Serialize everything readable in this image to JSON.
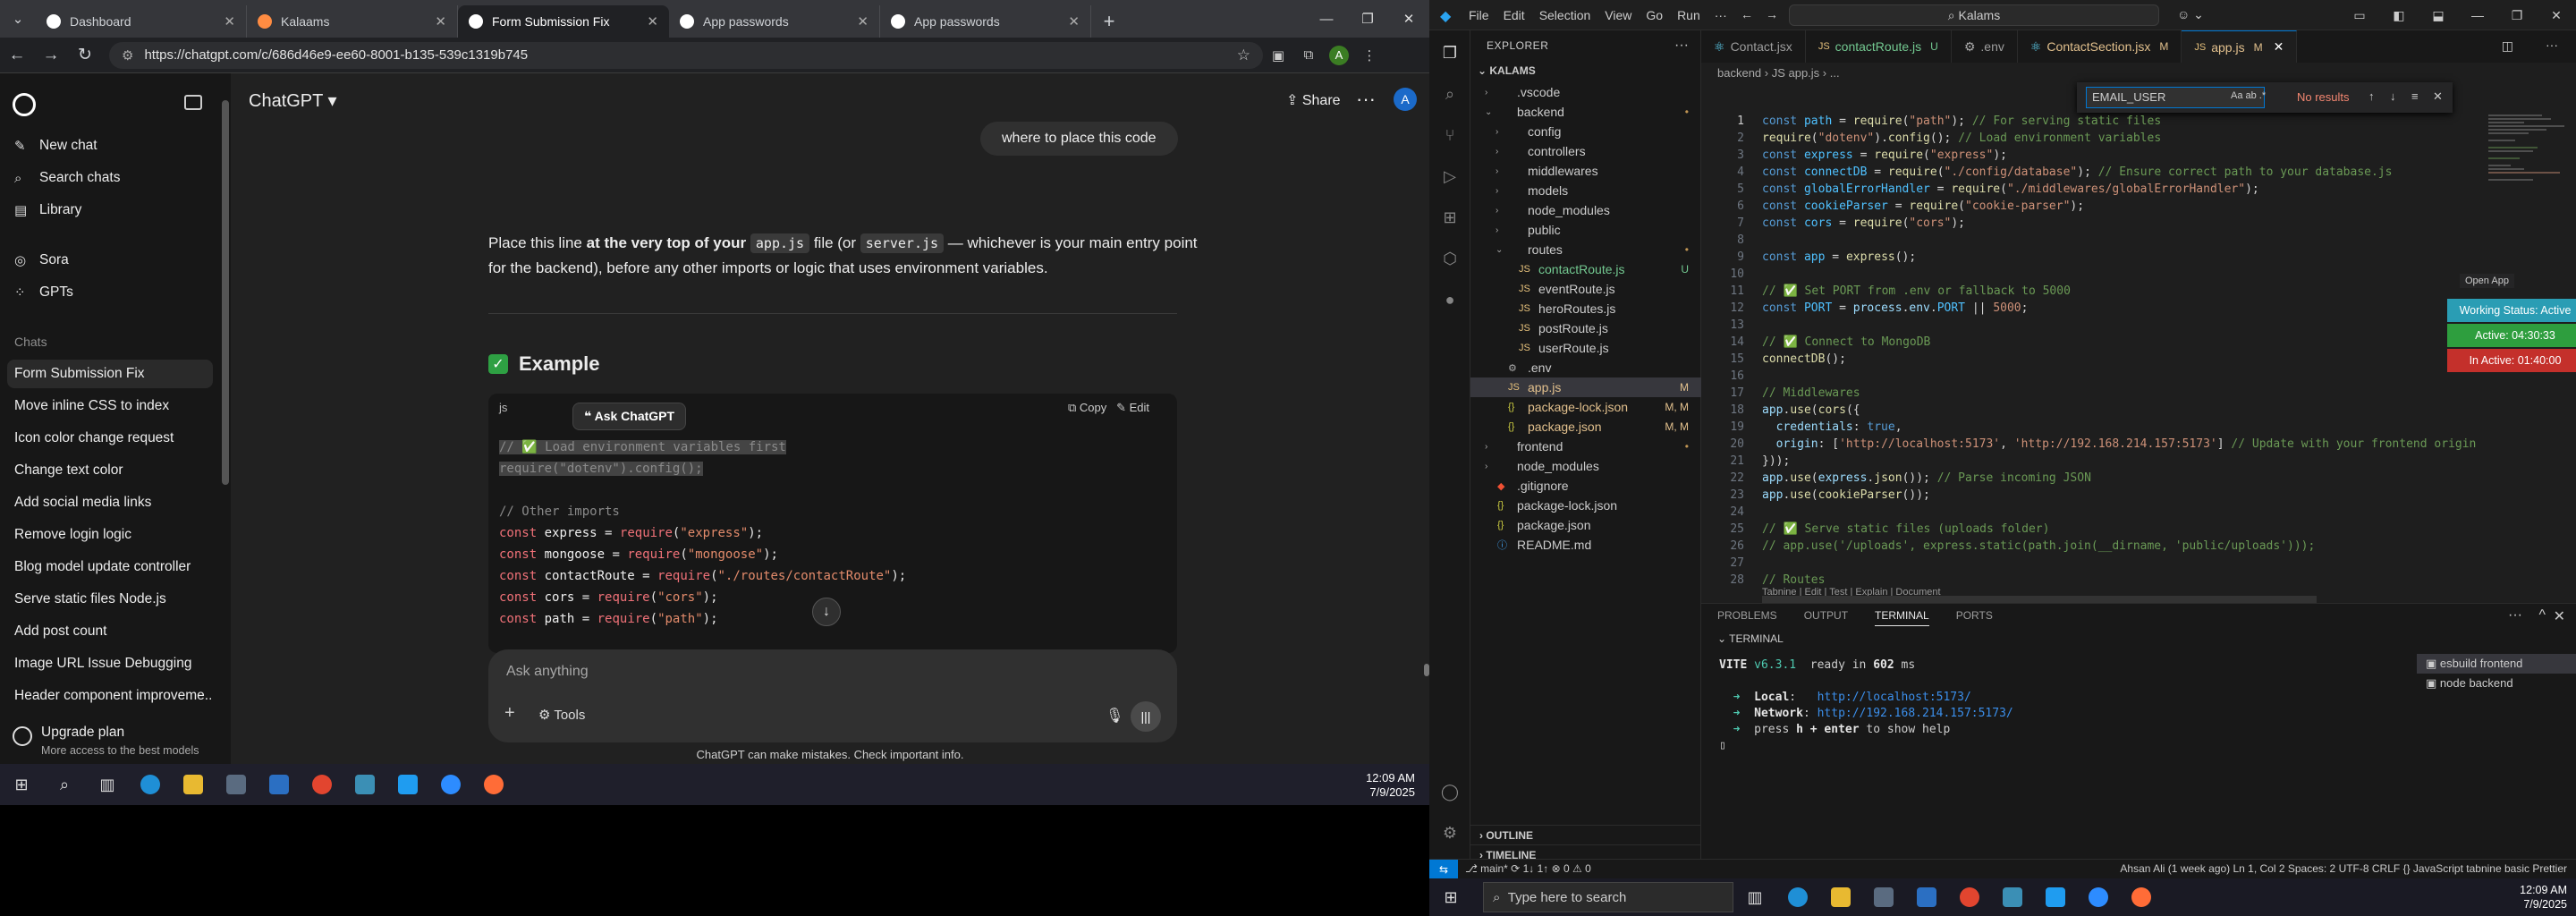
{
  "browser": {
    "tabs": [
      {
        "title": "Dashboard",
        "color": "#ffffff"
      },
      {
        "title": "Kalaams",
        "color": "#ff8c42"
      },
      {
        "title": "Form Submission Fix",
        "color": "#ffffff"
      },
      {
        "title": "App passwords",
        "color": "#ffffff"
      },
      {
        "title": "App passwords",
        "color": "#ffffff"
      }
    ],
    "url": "https://chatgpt.com/c/686d46e9-ee60-8001-b135-539c1319b745"
  },
  "sidebar": {
    "new_chat": "New chat",
    "search": "Search chats",
    "library": "Library",
    "sora": "Sora",
    "gpts": "GPTs",
    "chats_label": "Chats",
    "chats": [
      "Form Submission Fix",
      "Move inline CSS to index",
      "Icon color change request",
      "Change text color",
      "Add social media links",
      "Remove login logic",
      "Blog model update controller",
      "Serve static files Node.js",
      "Add post count",
      "Image URL Issue Debugging",
      "Header component improveme..."
    ],
    "upgrade_title": "Upgrade plan",
    "upgrade_sub": "More access to the best models"
  },
  "main": {
    "model": "ChatGPT ▾",
    "share": "Share",
    "user_initial": "A",
    "user_bubble": "where to place this code",
    "para_a": "Place this line ",
    "para_b": "at the very top of your",
    "para_c": "file (or",
    "para_d": "— whichever is your main entry point for the backend), before any other imports or logic that uses environment variables.",
    "code1": "app.js",
    "code2": "server.js",
    "example": "Example",
    "code_lang": "js",
    "copy": "Copy",
    "edit": "Edit",
    "ask_popup": "Ask ChatGPT",
    "placeholder": "Ask anything",
    "tools": "Tools",
    "disclaimer": "ChatGPT can make mistakes. Check important info."
  },
  "left_clock": {
    "time": "12:09 AM",
    "date": "7/9/2025"
  },
  "vscode": {
    "menu": [
      "File",
      "Edit",
      "Selection",
      "View",
      "Go",
      "Run",
      "···"
    ],
    "search": "Kalams",
    "explorer": "EXPLORER",
    "root": "KALAMS",
    "tree": [
      {
        "name": ".vscode",
        "depth": 1,
        "type": "folder",
        "open": false,
        "badge": ""
      },
      {
        "name": "backend",
        "depth": 1,
        "type": "folder",
        "open": true,
        "badge": "•"
      },
      {
        "name": "config",
        "depth": 2,
        "type": "folder",
        "open": false,
        "badge": ""
      },
      {
        "name": "controllers",
        "depth": 2,
        "type": "folder",
        "open": false,
        "badge": ""
      },
      {
        "name": "middlewares",
        "depth": 2,
        "type": "folder",
        "open": false,
        "badge": ""
      },
      {
        "name": "models",
        "depth": 2,
        "type": "folder",
        "open": false,
        "badge": ""
      },
      {
        "name": "node_modules",
        "depth": 2,
        "type": "folder",
        "open": false,
        "badge": ""
      },
      {
        "name": "public",
        "depth": 2,
        "type": "folder",
        "open": false,
        "badge": ""
      },
      {
        "name": "routes",
        "depth": 2,
        "type": "folder",
        "open": true,
        "badge": "•"
      },
      {
        "name": "contactRoute.js",
        "depth": 3,
        "type": "js",
        "badge": "U"
      },
      {
        "name": "eventRoute.js",
        "depth": 3,
        "type": "js",
        "badge": ""
      },
      {
        "name": "heroRoutes.js",
        "depth": 3,
        "type": "js",
        "badge": ""
      },
      {
        "name": "postRoute.js",
        "depth": 3,
        "type": "js",
        "badge": ""
      },
      {
        "name": "userRoute.js",
        "depth": 3,
        "type": "js",
        "badge": ""
      },
      {
        "name": ".env",
        "depth": 2,
        "type": "env",
        "badge": ""
      },
      {
        "name": "app.js",
        "depth": 2,
        "type": "js",
        "badge": "M",
        "selected": true
      },
      {
        "name": "package-lock.json",
        "depth": 2,
        "type": "json",
        "badge": "M, M"
      },
      {
        "name": "package.json",
        "depth": 2,
        "type": "json",
        "badge": "M, M"
      },
      {
        "name": "frontend",
        "depth": 1,
        "type": "folder",
        "open": false,
        "badge": "•"
      },
      {
        "name": "node_modules",
        "depth": 1,
        "type": "folder",
        "open": false,
        "badge": ""
      },
      {
        "name": ".gitignore",
        "depth": 1,
        "type": "git",
        "badge": ""
      },
      {
        "name": "package-lock.json",
        "depth": 1,
        "type": "json",
        "badge": ""
      },
      {
        "name": "package.json",
        "depth": 1,
        "type": "json",
        "badge": ""
      },
      {
        "name": "README.md",
        "depth": 1,
        "type": "md",
        "badge": ""
      }
    ],
    "outline": "OUTLINE",
    "timeline": "TIMELINE",
    "tabs": [
      {
        "name": "Contact.jsx",
        "mark": ""
      },
      {
        "name": "contactRoute.js",
        "mark": "U"
      },
      {
        "name": ".env",
        "mark": ""
      },
      {
        "name": "ContactSection.jsx",
        "mark": "M"
      },
      {
        "name": "app.js",
        "mark": "M",
        "active": true
      }
    ],
    "breadcrumb": "backend › JS app.js › ...",
    "find_value": "EMAIL_USER",
    "find_result": "No results",
    "codelens": "Tabnine | Edit | Test | Explain | Document",
    "open_app": "Open App",
    "status_widgets": [
      {
        "text": "Working Status: Active",
        "color": "#2a9db4"
      },
      {
        "text": "Active: 04:30:33",
        "color": "#2e9e3e"
      },
      {
        "text": "In Active: 01:40:00",
        "color": "#c4302b"
      }
    ],
    "panel_tabs": [
      "PROBLEMS",
      "OUTPUT",
      "TERMINAL",
      "PORTS"
    ],
    "terminal_label": "TERMINAL",
    "term_list": [
      "esbuild frontend",
      "node backend"
    ],
    "status_left": "⎇ main*   ⟳ 1↓ 1↑   ⊗ 0 ⚠ 0",
    "status_right": "Ahsan Ali (1 week ago)    Ln 1, Col 2    Spaces: 2    UTF-8    CRLF    {} JavaScript    tabnine basic    Prettier",
    "taskbar_search": "Type here to search",
    "clock": {
      "time": "12:09 AM",
      "date": "7/9/2025"
    }
  }
}
